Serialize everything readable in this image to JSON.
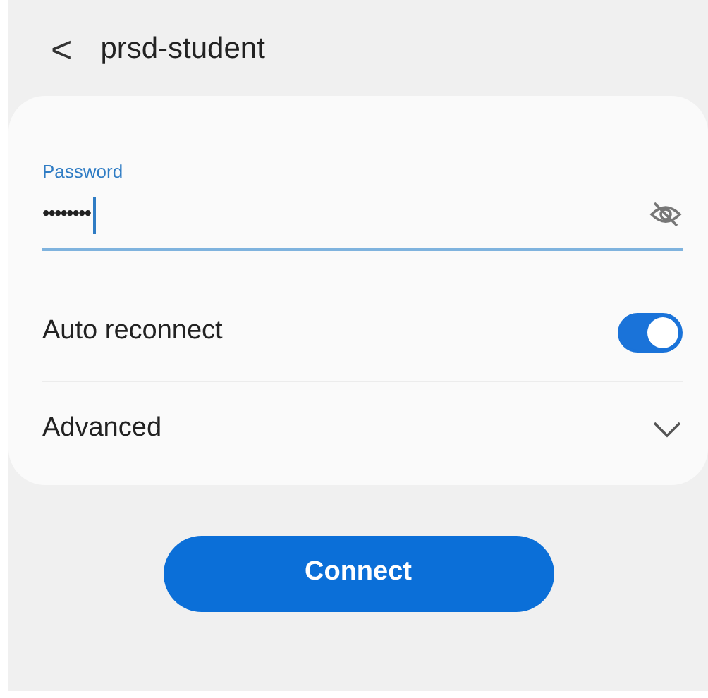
{
  "header": {
    "back": "<",
    "title": "prsd-student"
  },
  "password": {
    "label": "Password",
    "value": "••••••••",
    "focused": true,
    "visible": false
  },
  "settings": [
    {
      "kind": "toggle",
      "label": "Auto reconnect",
      "on": true
    },
    {
      "kind": "expander",
      "label": "Advanced",
      "expanded": false
    }
  ],
  "button": "Connect"
}
